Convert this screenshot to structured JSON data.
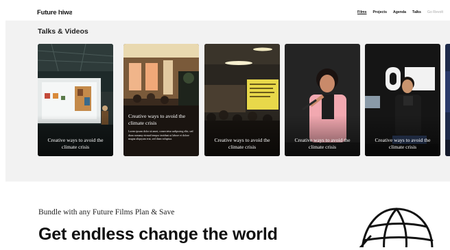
{
  "header": {
    "logo_text": "Future",
    "logo_mirrored": "swirl",
    "nav": [
      {
        "label": "Films",
        "active": true
      },
      {
        "label": "Projects",
        "active": false
      },
      {
        "label": "Agenda",
        "active": false
      },
      {
        "label": "Talks",
        "active": false
      },
      {
        "label": "Go Revolt",
        "active": false
      }
    ]
  },
  "section": {
    "title": "Talks & Videos"
  },
  "cards": [
    {
      "caption": "Creative ways to avoid the climate crisis"
    },
    {
      "caption": "Creative ways to avoid the climate crisis",
      "description": "Lorem ipsum dolor sit amet, consectetur sadipscing elitr, sed diam nonumy eirmod tempor invidunt ut labore et dolore magna aliquyam erat, sed diam voluptua."
    },
    {
      "caption": "Creative ways to avoid the climate crisis"
    },
    {
      "caption": "Creative ways to avoid the climate crisis"
    },
    {
      "caption": "Creative ways to avoid the climate crisis"
    }
  ],
  "promo": {
    "bundle_text": "Bundle with any Future Films Plan & Save",
    "headline": "Get endless change the world"
  },
  "colors": {
    "background": "#f2f2f2",
    "card_dark": "#1c1c1c",
    "text": "#111111"
  }
}
